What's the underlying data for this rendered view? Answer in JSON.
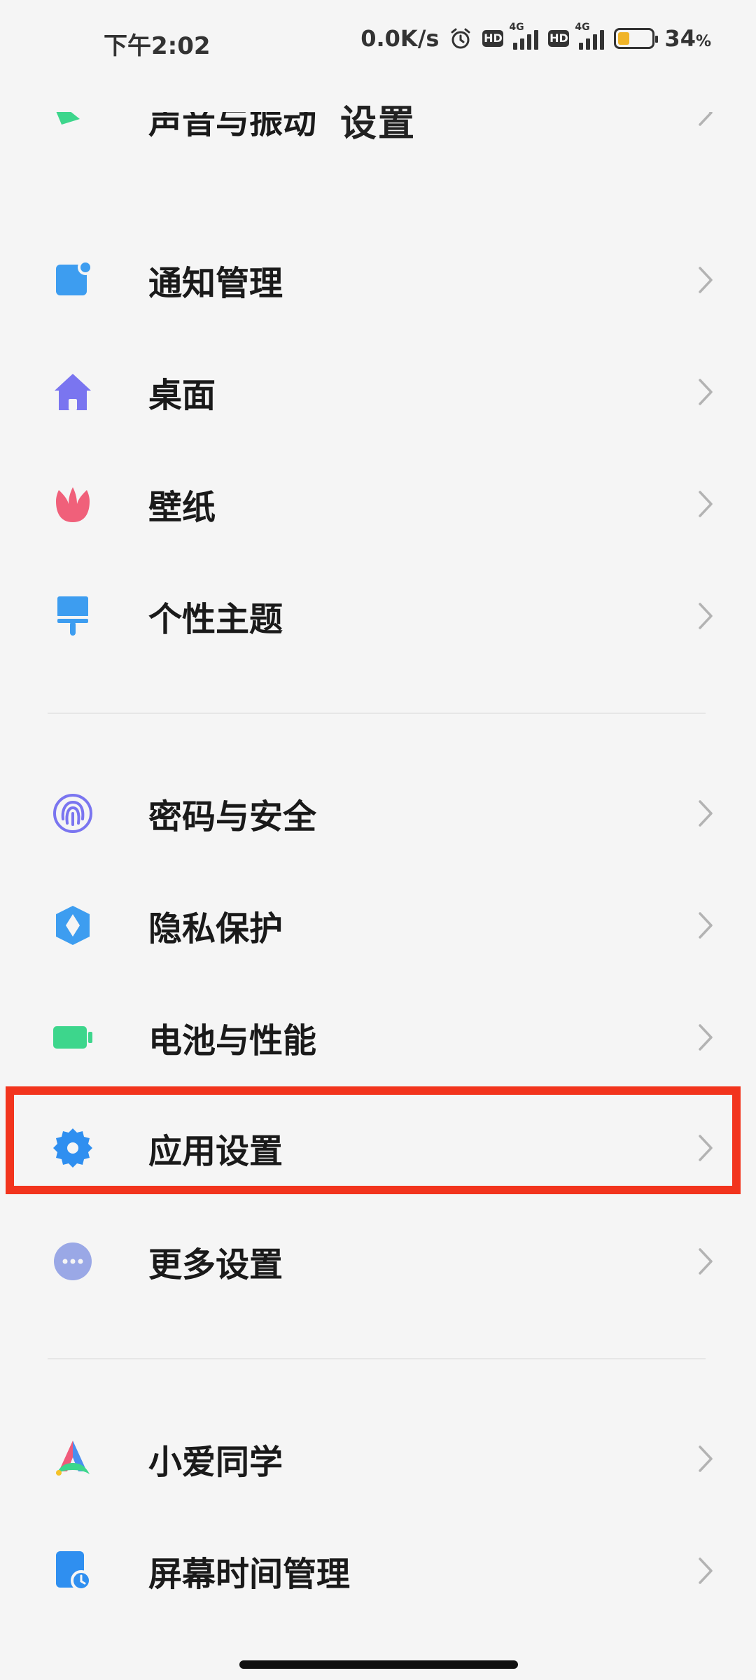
{
  "status_bar": {
    "time": "下午2:02",
    "net_speed": "0.0K/s",
    "hd1": "HD",
    "sig1": "4G",
    "hd2": "HD",
    "sig2": "4G",
    "battery_pct": "34",
    "battery_unit": "%",
    "battery_level": 0.34
  },
  "header": {
    "title": "设置"
  },
  "settings": {
    "partial_item": "声音与振动",
    "items": [
      {
        "label": "通知管理",
        "icon": "notification-icon",
        "color": "#3d9df0"
      },
      {
        "label": "桌面",
        "icon": "home-icon",
        "color": "#7a75f0"
      },
      {
        "label": "壁纸",
        "icon": "flower-icon",
        "color": "#f0607a"
      },
      {
        "label": "个性主题",
        "icon": "brush-icon",
        "color": "#3d9df0"
      },
      {
        "label": "密码与安全",
        "icon": "fingerprint-icon",
        "color": "#7a75f0"
      },
      {
        "label": "隐私保护",
        "icon": "shield-icon",
        "color": "#3d9df0"
      },
      {
        "label": "电池与性能",
        "icon": "battery-icon",
        "color": "#3dd68c"
      },
      {
        "label": "应用设置",
        "icon": "gear-icon",
        "color": "#2f8ff0"
      },
      {
        "label": "更多设置",
        "icon": "more-icon",
        "color": "#9aa8e6"
      },
      {
        "label": "小爱同学",
        "icon": "xiaoai-icon",
        "color": "#f05a7a"
      },
      {
        "label": "屏幕时间管理",
        "icon": "screen-time-icon",
        "color": "#2f8ff0"
      }
    ]
  },
  "highlight_color": "#f2341d"
}
